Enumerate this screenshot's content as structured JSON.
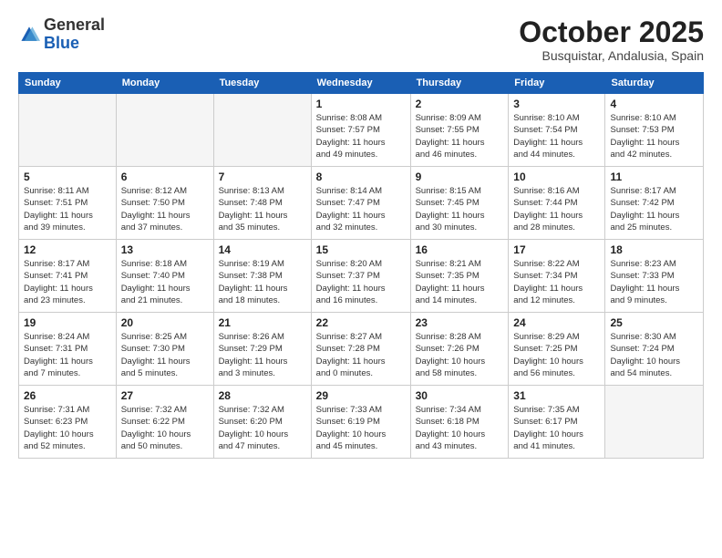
{
  "header": {
    "logo_general": "General",
    "logo_blue": "Blue",
    "month_title": "October 2025",
    "subtitle": "Busquistar, Andalusia, Spain"
  },
  "days_of_week": [
    "Sunday",
    "Monday",
    "Tuesday",
    "Wednesday",
    "Thursday",
    "Friday",
    "Saturday"
  ],
  "weeks": [
    [
      {
        "day": "",
        "info": ""
      },
      {
        "day": "",
        "info": ""
      },
      {
        "day": "",
        "info": ""
      },
      {
        "day": "1",
        "info": "Sunrise: 8:08 AM\nSunset: 7:57 PM\nDaylight: 11 hours\nand 49 minutes."
      },
      {
        "day": "2",
        "info": "Sunrise: 8:09 AM\nSunset: 7:55 PM\nDaylight: 11 hours\nand 46 minutes."
      },
      {
        "day": "3",
        "info": "Sunrise: 8:10 AM\nSunset: 7:54 PM\nDaylight: 11 hours\nand 44 minutes."
      },
      {
        "day": "4",
        "info": "Sunrise: 8:10 AM\nSunset: 7:53 PM\nDaylight: 11 hours\nand 42 minutes."
      }
    ],
    [
      {
        "day": "5",
        "info": "Sunrise: 8:11 AM\nSunset: 7:51 PM\nDaylight: 11 hours\nand 39 minutes."
      },
      {
        "day": "6",
        "info": "Sunrise: 8:12 AM\nSunset: 7:50 PM\nDaylight: 11 hours\nand 37 minutes."
      },
      {
        "day": "7",
        "info": "Sunrise: 8:13 AM\nSunset: 7:48 PM\nDaylight: 11 hours\nand 35 minutes."
      },
      {
        "day": "8",
        "info": "Sunrise: 8:14 AM\nSunset: 7:47 PM\nDaylight: 11 hours\nand 32 minutes."
      },
      {
        "day": "9",
        "info": "Sunrise: 8:15 AM\nSunset: 7:45 PM\nDaylight: 11 hours\nand 30 minutes."
      },
      {
        "day": "10",
        "info": "Sunrise: 8:16 AM\nSunset: 7:44 PM\nDaylight: 11 hours\nand 28 minutes."
      },
      {
        "day": "11",
        "info": "Sunrise: 8:17 AM\nSunset: 7:42 PM\nDaylight: 11 hours\nand 25 minutes."
      }
    ],
    [
      {
        "day": "12",
        "info": "Sunrise: 8:17 AM\nSunset: 7:41 PM\nDaylight: 11 hours\nand 23 minutes."
      },
      {
        "day": "13",
        "info": "Sunrise: 8:18 AM\nSunset: 7:40 PM\nDaylight: 11 hours\nand 21 minutes."
      },
      {
        "day": "14",
        "info": "Sunrise: 8:19 AM\nSunset: 7:38 PM\nDaylight: 11 hours\nand 18 minutes."
      },
      {
        "day": "15",
        "info": "Sunrise: 8:20 AM\nSunset: 7:37 PM\nDaylight: 11 hours\nand 16 minutes."
      },
      {
        "day": "16",
        "info": "Sunrise: 8:21 AM\nSunset: 7:35 PM\nDaylight: 11 hours\nand 14 minutes."
      },
      {
        "day": "17",
        "info": "Sunrise: 8:22 AM\nSunset: 7:34 PM\nDaylight: 11 hours\nand 12 minutes."
      },
      {
        "day": "18",
        "info": "Sunrise: 8:23 AM\nSunset: 7:33 PM\nDaylight: 11 hours\nand 9 minutes."
      }
    ],
    [
      {
        "day": "19",
        "info": "Sunrise: 8:24 AM\nSunset: 7:31 PM\nDaylight: 11 hours\nand 7 minutes."
      },
      {
        "day": "20",
        "info": "Sunrise: 8:25 AM\nSunset: 7:30 PM\nDaylight: 11 hours\nand 5 minutes."
      },
      {
        "day": "21",
        "info": "Sunrise: 8:26 AM\nSunset: 7:29 PM\nDaylight: 11 hours\nand 3 minutes."
      },
      {
        "day": "22",
        "info": "Sunrise: 8:27 AM\nSunset: 7:28 PM\nDaylight: 11 hours\nand 0 minutes."
      },
      {
        "day": "23",
        "info": "Sunrise: 8:28 AM\nSunset: 7:26 PM\nDaylight: 10 hours\nand 58 minutes."
      },
      {
        "day": "24",
        "info": "Sunrise: 8:29 AM\nSunset: 7:25 PM\nDaylight: 10 hours\nand 56 minutes."
      },
      {
        "day": "25",
        "info": "Sunrise: 8:30 AM\nSunset: 7:24 PM\nDaylight: 10 hours\nand 54 minutes."
      }
    ],
    [
      {
        "day": "26",
        "info": "Sunrise: 7:31 AM\nSunset: 6:23 PM\nDaylight: 10 hours\nand 52 minutes."
      },
      {
        "day": "27",
        "info": "Sunrise: 7:32 AM\nSunset: 6:22 PM\nDaylight: 10 hours\nand 50 minutes."
      },
      {
        "day": "28",
        "info": "Sunrise: 7:32 AM\nSunset: 6:20 PM\nDaylight: 10 hours\nand 47 minutes."
      },
      {
        "day": "29",
        "info": "Sunrise: 7:33 AM\nSunset: 6:19 PM\nDaylight: 10 hours\nand 45 minutes."
      },
      {
        "day": "30",
        "info": "Sunrise: 7:34 AM\nSunset: 6:18 PM\nDaylight: 10 hours\nand 43 minutes."
      },
      {
        "day": "31",
        "info": "Sunrise: 7:35 AM\nSunset: 6:17 PM\nDaylight: 10 hours\nand 41 minutes."
      },
      {
        "day": "",
        "info": ""
      }
    ]
  ]
}
